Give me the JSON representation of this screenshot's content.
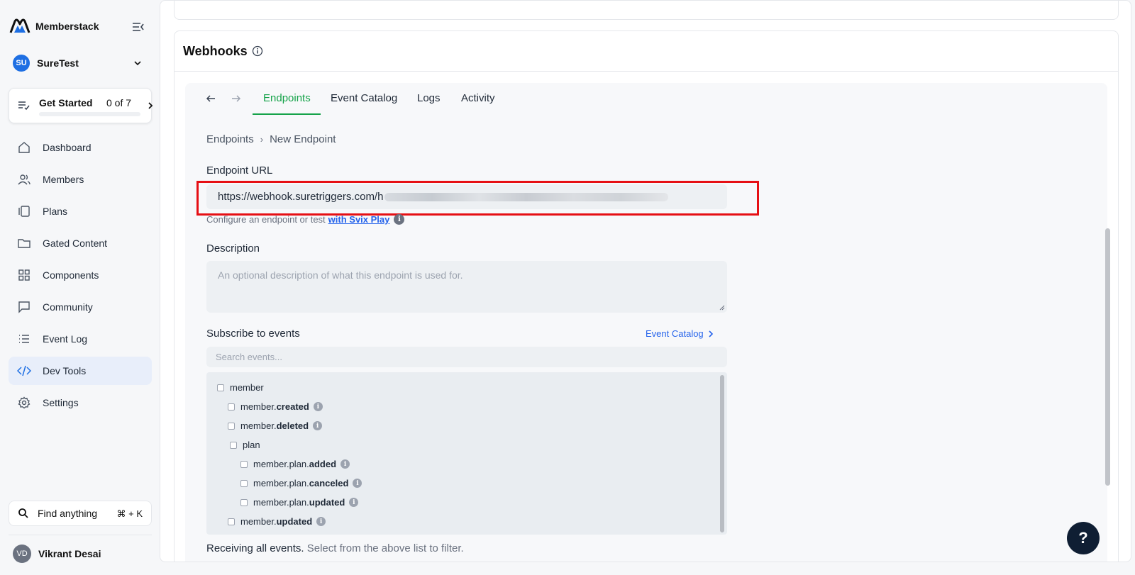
{
  "app": {
    "name": "Memberstack"
  },
  "workspace": {
    "initials": "SU",
    "name": "SureTest"
  },
  "get_started": {
    "label": "Get Started",
    "count": "0 of 7",
    "progress": 0
  },
  "sidebar": {
    "items": [
      {
        "label": "Dashboard",
        "icon": "home-icon"
      },
      {
        "label": "Members",
        "icon": "users-icon"
      },
      {
        "label": "Plans",
        "icon": "plans-icon"
      },
      {
        "label": "Gated Content",
        "icon": "folder-icon"
      },
      {
        "label": "Components",
        "icon": "grid-icon"
      },
      {
        "label": "Community",
        "icon": "chat-icon"
      },
      {
        "label": "Event Log",
        "icon": "list-icon"
      },
      {
        "label": "Dev Tools",
        "icon": "code-icon",
        "active": true
      },
      {
        "label": "Settings",
        "icon": "gear-icon"
      }
    ]
  },
  "find": {
    "label": "Find anything",
    "shortcut": "⌘ + K"
  },
  "user": {
    "initials": "VD",
    "name": "Vikrant Desai"
  },
  "webhooks": {
    "title": "Webhooks"
  },
  "tabs": [
    {
      "label": "Endpoints",
      "active": true
    },
    {
      "label": "Event Catalog"
    },
    {
      "label": "Logs"
    },
    {
      "label": "Activity"
    }
  ],
  "breadcrumb": {
    "parent": "Endpoints",
    "separator": "›",
    "current": "New Endpoint"
  },
  "endpoint_url": {
    "label": "Endpoint URL",
    "value": "https://webhook.suretriggers.com/h"
  },
  "help": {
    "text": "Configure an endpoint or test",
    "link": "with Svix Play"
  },
  "description": {
    "label": "Description",
    "placeholder": "An optional description of what this endpoint is used for."
  },
  "subscribe": {
    "label": "Subscribe to events",
    "catalog_link": "Event Catalog",
    "search_placeholder": "Search events..."
  },
  "events": [
    {
      "prefix": "",
      "bold": "",
      "plain": "member",
      "info": false
    },
    {
      "prefix": "member.",
      "bold": "created",
      "plain": "",
      "info": true
    },
    {
      "prefix": "member.",
      "bold": "deleted",
      "plain": "",
      "info": true
    },
    {
      "prefix": "",
      "bold": "",
      "plain": "plan",
      "info": false
    },
    {
      "prefix": "member.plan.",
      "bold": "added",
      "plain": "",
      "info": true
    },
    {
      "prefix": "member.plan.",
      "bold": "canceled",
      "plain": "",
      "info": true
    },
    {
      "prefix": "member.plan.",
      "bold": "updated",
      "plain": "",
      "info": true
    },
    {
      "prefix": "member.",
      "bold": "updated",
      "plain": "",
      "info": true
    }
  ],
  "receiving": {
    "strong": "Receiving all events.",
    "rest": "Select from the above list to filter."
  },
  "help_fab": {
    "label": "?"
  },
  "colors": {
    "accent_green": "#16a34a",
    "link_blue": "#2563eb",
    "highlight_red": "#e60f14",
    "avatar_blue": "#1e6fe3"
  }
}
